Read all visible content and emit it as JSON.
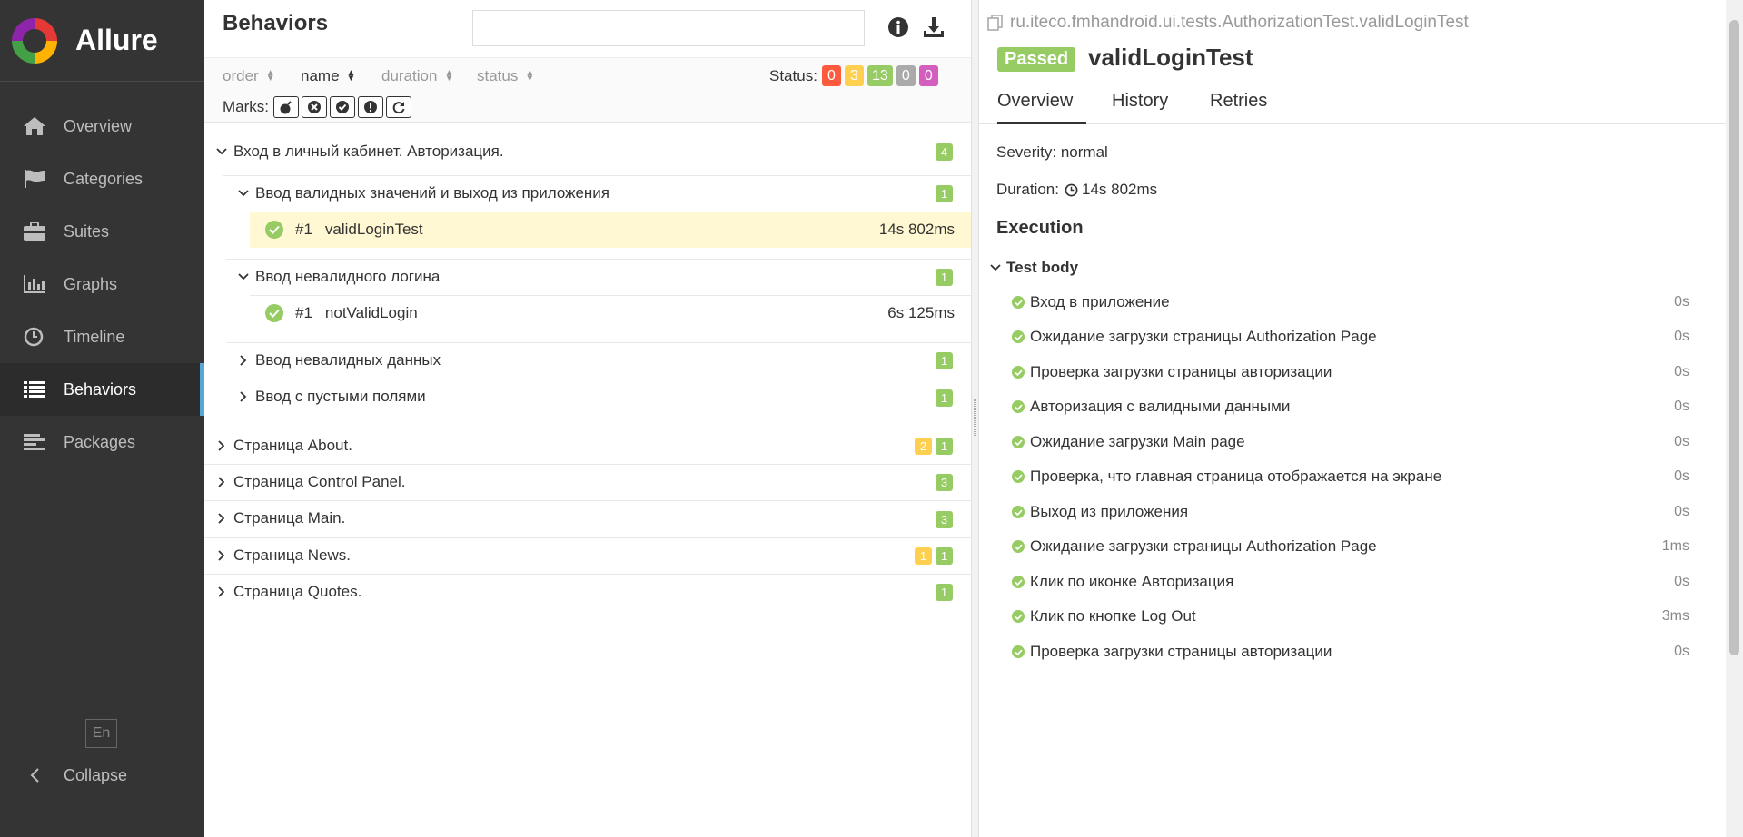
{
  "brand": {
    "name": "Allure"
  },
  "nav": [
    {
      "label": "Overview",
      "icon": "home-icon"
    },
    {
      "label": "Categories",
      "icon": "flag-icon"
    },
    {
      "label": "Suites",
      "icon": "briefcase-icon"
    },
    {
      "label": "Graphs",
      "icon": "bar-chart-icon"
    },
    {
      "label": "Timeline",
      "icon": "clock-icon"
    },
    {
      "label": "Behaviors",
      "icon": "list-icon",
      "active": true
    },
    {
      "label": "Packages",
      "icon": "align-left-icon"
    }
  ],
  "sidebar_footer": {
    "lang": "En",
    "collapse": "Collapse"
  },
  "behaviors": {
    "title": "Behaviors",
    "search_placeholder": "",
    "sort": {
      "order": "order",
      "name": "name",
      "duration": "duration",
      "status": "status"
    },
    "status_label": "Status:",
    "status_counts": {
      "failed": "0",
      "broken": "3",
      "passed": "13",
      "skipped": "0",
      "unknown": "0"
    },
    "marks_label": "Marks:",
    "tree": {
      "feature1": {
        "label": "Вход в личный кабинет. Авторизация.",
        "passed": "4"
      },
      "story1": {
        "label": "Ввод валидных значений и выход из приложения",
        "passed": "1"
      },
      "case1": {
        "num": "#1",
        "name": "validLoginTest",
        "duration": "14s 802ms"
      },
      "story2": {
        "label": "Ввод невалидного логина",
        "passed": "1"
      },
      "case2": {
        "num": "#1",
        "name": "notValidLogin",
        "duration": "6s 125ms"
      },
      "story3": {
        "label": "Ввод невалидных данных",
        "passed": "1"
      },
      "story4": {
        "label": "Ввод с пустыми полями",
        "passed": "1"
      },
      "feature2": {
        "label": "Страница About.",
        "broken": "2",
        "passed": "1"
      },
      "feature3": {
        "label": "Страница Control Panel.",
        "passed": "3"
      },
      "feature4": {
        "label": "Страница Main.",
        "passed": "3"
      },
      "feature5": {
        "label": "Страница News.",
        "broken": "1",
        "passed": "1"
      },
      "feature6": {
        "label": "Страница Quotes.",
        "passed": "1"
      }
    }
  },
  "detail": {
    "path": "ru.iteco.fmhandroid.ui.tests.AuthorizationTest.validLoginTest",
    "status": "Passed",
    "title": "validLoginTest",
    "tabs": {
      "overview": "Overview",
      "history": "History",
      "retries": "Retries"
    },
    "severity": "Severity: normal",
    "duration_label": "Duration:",
    "duration": "14s 802ms",
    "execution": "Execution",
    "test_body": "Test body",
    "steps": [
      {
        "name": "Вход в приложение",
        "duration": "0s"
      },
      {
        "name": "Ожидание загрузки страницы Authorization Page",
        "duration": "0s"
      },
      {
        "name": "Проверка загрузки страницы авторизации",
        "duration": "0s"
      },
      {
        "name": "Авторизация с валидными данными",
        "duration": "0s"
      },
      {
        "name": "Ожидание загрузки Main page",
        "duration": "0s"
      },
      {
        "name": "Проверка, что главная страница отображается на экране",
        "duration": "0s"
      },
      {
        "name": "Выход из приложения",
        "duration": "0s"
      },
      {
        "name": "Ожидание загрузки страницы Authorization Page",
        "duration": "1ms"
      },
      {
        "name": "Клик по иконке Авторизация",
        "duration": "0s"
      },
      {
        "name": "Клик по кнопке Log Out",
        "duration": "3ms"
      },
      {
        "name": "Проверка загрузки страницы авторизации",
        "duration": "0s"
      }
    ]
  },
  "colors": {
    "sidebar": "#343434",
    "passed": "#97cc64",
    "broken": "#ffd050",
    "failed": "#fd5a3e",
    "skipped": "#aaaaaa",
    "unknown": "#d35ebe",
    "accent": "#56a6d6",
    "selected_row": "#fff8d2"
  }
}
